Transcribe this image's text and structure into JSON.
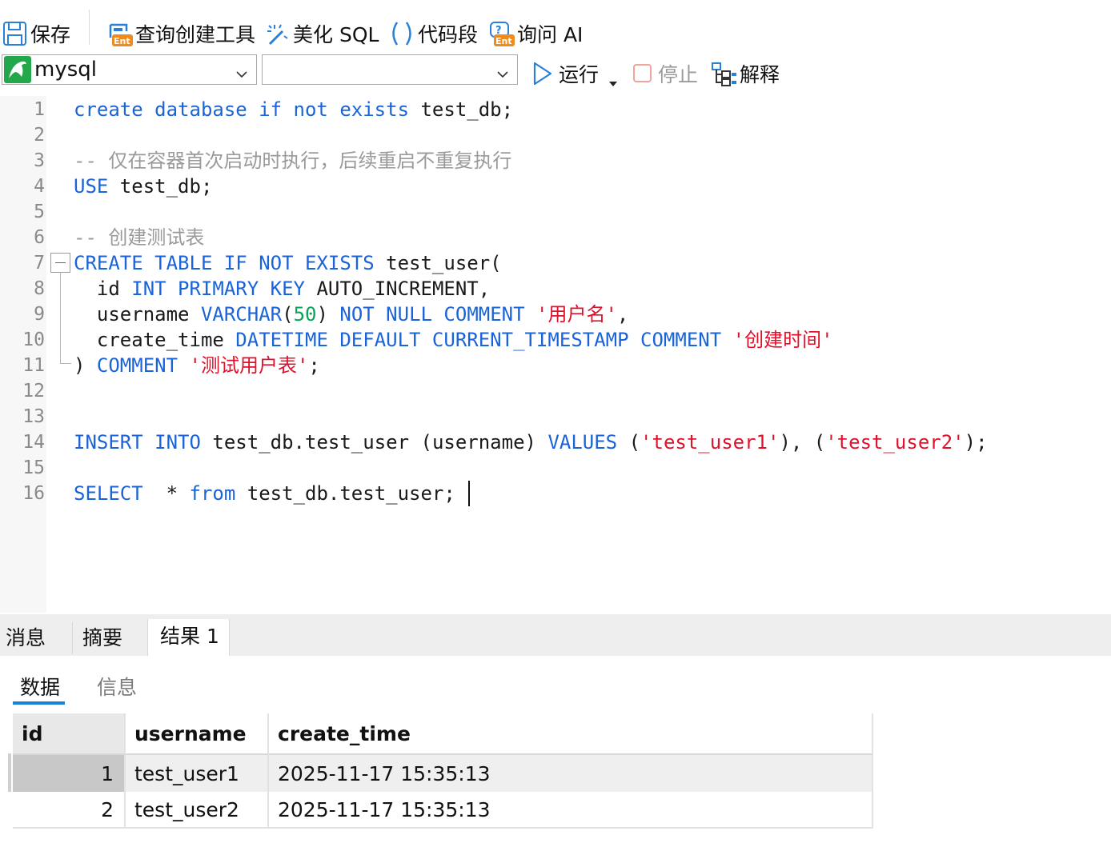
{
  "toolbar": {
    "save": "保存",
    "query_builder": "查询创建工具",
    "beautify": "美化 SQL",
    "snippet": "代码段",
    "ask_ai": "询问 AI",
    "ent_badge": "Ent"
  },
  "connection": {
    "selected": "mysql",
    "database_selected": ""
  },
  "actions": {
    "run": "运行",
    "stop": "停止",
    "explain": "解释"
  },
  "editor": {
    "line_numbers": [
      "1",
      "2",
      "3",
      "4",
      "5",
      "6",
      "7",
      "8",
      "9",
      "10",
      "11",
      "12",
      "13",
      "14",
      "15",
      "16"
    ],
    "lines": [
      [
        {
          "t": "kw",
          "v": "create database if not exists"
        },
        {
          "t": "plain",
          "v": " test_db;"
        }
      ],
      [],
      [
        {
          "t": "cmt",
          "v": "-- 仅在容器首次启动时执行，后续重启不重复执行"
        }
      ],
      [
        {
          "t": "kw",
          "v": "USE"
        },
        {
          "t": "plain",
          "v": " test_db;"
        }
      ],
      [],
      [
        {
          "t": "cmt",
          "v": "-- 创建测试表"
        }
      ],
      [
        {
          "t": "kw",
          "v": "CREATE TABLE IF NOT EXISTS"
        },
        {
          "t": "plain",
          "v": " test_user("
        }
      ],
      [
        {
          "t": "plain",
          "v": "  id "
        },
        {
          "t": "kw",
          "v": "INT PRIMARY KEY"
        },
        {
          "t": "plain",
          "v": " AUTO_INCREMENT,"
        }
      ],
      [
        {
          "t": "plain",
          "v": "  username "
        },
        {
          "t": "kw",
          "v": "VARCHAR"
        },
        {
          "t": "plain",
          "v": "("
        },
        {
          "t": "num",
          "v": "50"
        },
        {
          "t": "plain",
          "v": ") "
        },
        {
          "t": "kw",
          "v": "NOT NULL COMMENT"
        },
        {
          "t": "plain",
          "v": " "
        },
        {
          "t": "str",
          "v": "'用户名'"
        },
        {
          "t": "plain",
          "v": ","
        }
      ],
      [
        {
          "t": "plain",
          "v": "  create_time "
        },
        {
          "t": "kw",
          "v": "DATETIME DEFAULT CURRENT_TIMESTAMP COMMENT"
        },
        {
          "t": "plain",
          "v": " "
        },
        {
          "t": "str",
          "v": "'创建时间'"
        }
      ],
      [
        {
          "t": "plain",
          "v": ") "
        },
        {
          "t": "kw",
          "v": "COMMENT"
        },
        {
          "t": "plain",
          "v": " "
        },
        {
          "t": "str",
          "v": "'测试用户表'"
        },
        {
          "t": "plain",
          "v": ";"
        }
      ],
      [],
      [],
      [
        {
          "t": "kw",
          "v": "INSERT INTO"
        },
        {
          "t": "plain",
          "v": " test_db.test_user (username) "
        },
        {
          "t": "kw",
          "v": "VALUES"
        },
        {
          "t": "plain",
          "v": " ("
        },
        {
          "t": "str",
          "v": "'test_user1'"
        },
        {
          "t": "plain",
          "v": "), ("
        },
        {
          "t": "str",
          "v": "'test_user2'"
        },
        {
          "t": "plain",
          "v": ");"
        }
      ],
      [],
      [
        {
          "t": "kw",
          "v": "SELECT"
        },
        {
          "t": "plain",
          "v": "  * "
        },
        {
          "t": "kw",
          "v": "from"
        },
        {
          "t": "plain",
          "v": " test_db.test_user;"
        }
      ]
    ]
  },
  "result_tabs": [
    "消息",
    "摘要",
    "结果 1"
  ],
  "sub_tabs": [
    "数据",
    "信息"
  ],
  "grid": {
    "columns": [
      "id",
      "username",
      "create_time"
    ],
    "rows": [
      [
        "1",
        "test_user1",
        "2025-11-17 15:35:13"
      ],
      [
        "2",
        "test_user2",
        "2025-11-17 15:35:13"
      ]
    ]
  },
  "colors": {
    "keyword": "#1a63d8",
    "string": "#e0112b",
    "number": "#08a45a",
    "comment": "#9a9a9a",
    "accent": "#1a83d6"
  }
}
